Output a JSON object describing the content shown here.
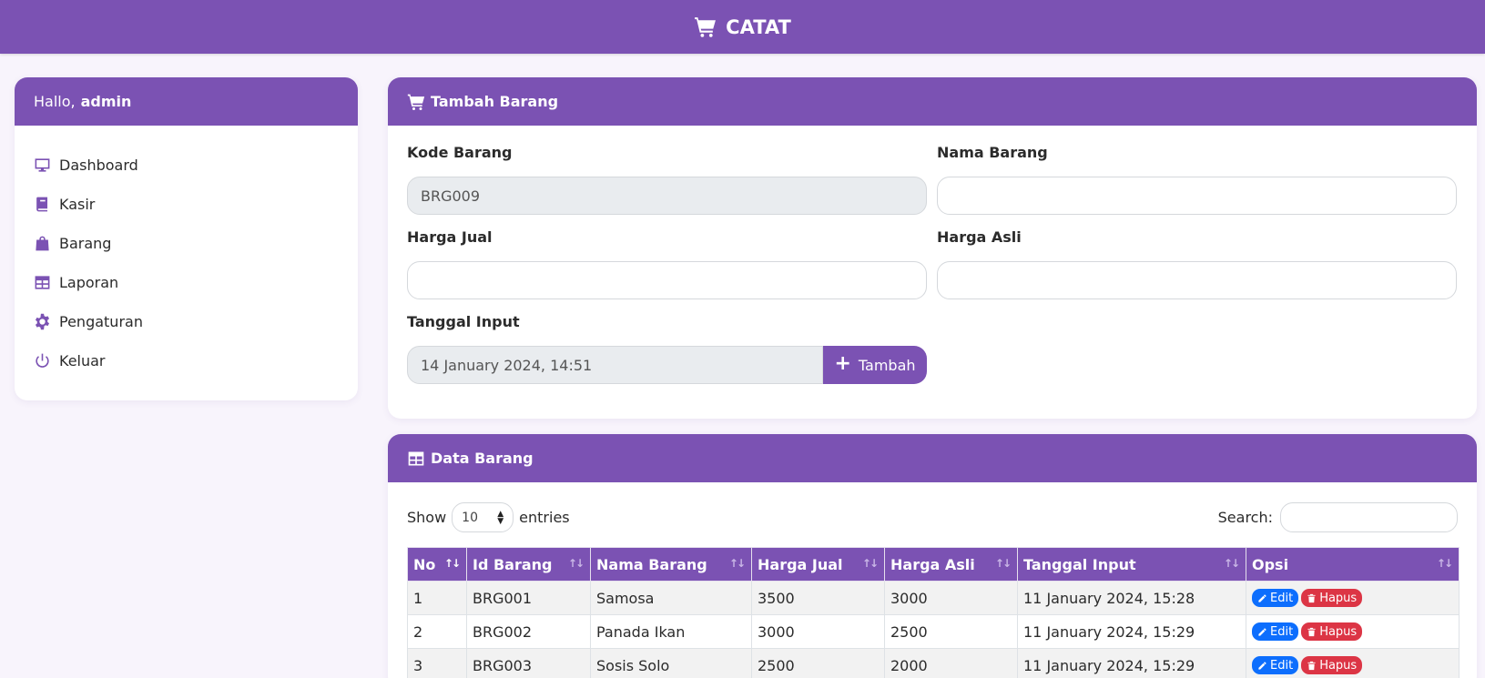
{
  "app": {
    "title": "CATAT",
    "accent": "#7b52b3",
    "icon": "cart-icon"
  },
  "sidebar": {
    "greeting": "Hallo,",
    "user": "admin",
    "items": [
      {
        "label": "Dashboard",
        "icon": "monitor-icon"
      },
      {
        "label": "Kasir",
        "icon": "book-icon"
      },
      {
        "label": "Barang",
        "icon": "bag-icon"
      },
      {
        "label": "Laporan",
        "icon": "table-icon"
      },
      {
        "label": "Pengaturan",
        "icon": "gear-icon"
      },
      {
        "label": "Keluar",
        "icon": "power-icon"
      }
    ]
  },
  "form": {
    "title": "Tambah Barang",
    "kode_label": "Kode Barang",
    "kode_value": "BRG009",
    "nama_label": "Nama Barang",
    "nama_value": "",
    "harga_jual_label": "Harga Jual",
    "harga_jual_value": "",
    "harga_asli_label": "Harga Asli",
    "harga_asli_value": "",
    "tanggal_label": "Tanggal Input",
    "tanggal_value": "14 January 2024, 14:51",
    "submit_label": "Tambah"
  },
  "table": {
    "title": "Data Barang",
    "show_label": "Show",
    "entries_value": "10",
    "entries_label": "entries",
    "search_label": "Search:",
    "columns": [
      "No",
      "Id Barang",
      "Nama Barang",
      "Harga Jual",
      "Harga Asli",
      "Tanggal Input",
      "Opsi"
    ],
    "edit_label": "Edit",
    "delete_label": "Hapus",
    "rows": [
      {
        "no": "1",
        "id": "BRG001",
        "nama": "Samosa",
        "jual": "3500",
        "asli": "3000",
        "tanggal": "11 January 2024, 15:28"
      },
      {
        "no": "2",
        "id": "BRG002",
        "nama": "Panada Ikan",
        "jual": "3000",
        "asli": "2500",
        "tanggal": "11 January 2024, 15:29"
      },
      {
        "no": "3",
        "id": "BRG003",
        "nama": "Sosis Solo",
        "jual": "2500",
        "asli": "2000",
        "tanggal": "11 January 2024, 15:29"
      }
    ]
  }
}
